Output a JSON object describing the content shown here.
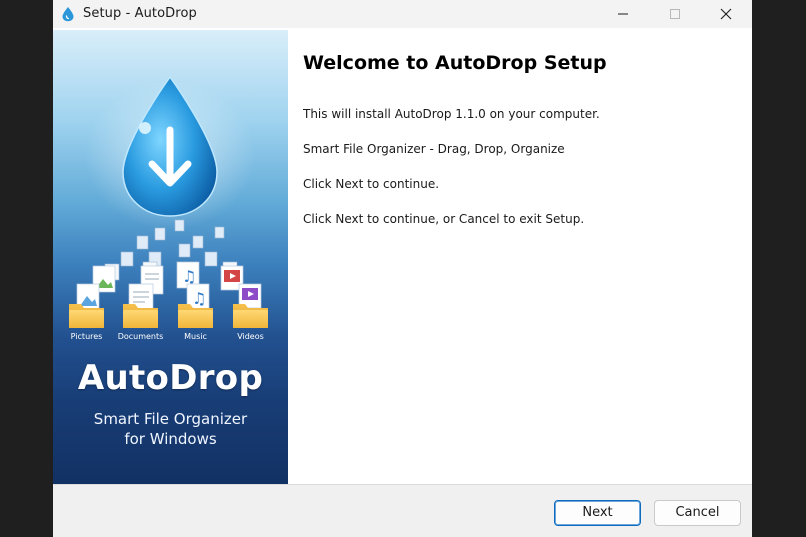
{
  "window": {
    "title": "Setup - AutoDrop"
  },
  "sidebar": {
    "folders": [
      {
        "label": "Pictures"
      },
      {
        "label": "Documents"
      },
      {
        "label": "Music"
      },
      {
        "label": "Videos"
      }
    ],
    "brand": {
      "name": "AutoDrop",
      "tagline_line1": "Smart File Organizer",
      "tagline_line2": "for Windows"
    }
  },
  "main": {
    "heading": "Welcome to AutoDrop Setup",
    "paragraphs": [
      "This will install AutoDrop 1.1.0 on your computer.",
      "Smart File Organizer - Drag, Drop, Organize",
      "Click Next to continue.",
      "Click Next to continue, or Cancel to exit Setup."
    ]
  },
  "footer": {
    "next_label": "Next",
    "cancel_label": "Cancel"
  },
  "icons": {
    "app": "water-drop-icon",
    "minimize": "minimize-icon",
    "maximize": "maximize-icon",
    "close": "close-icon"
  },
  "colors": {
    "accent": "#0f6cbd",
    "drop": "#1e8fd6",
    "sidebar_top": "#d9eef9",
    "sidebar_bottom": "#123164"
  }
}
